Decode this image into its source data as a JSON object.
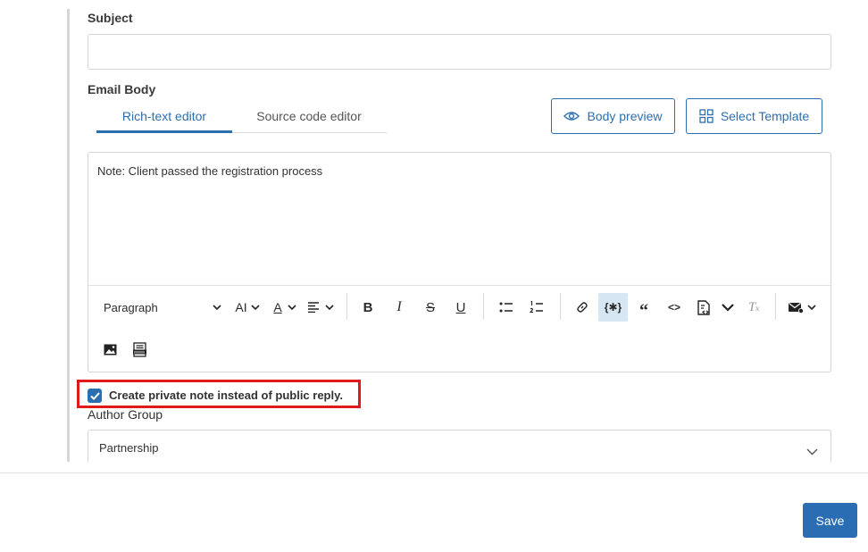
{
  "form": {
    "subject_label": "Subject",
    "subject_value": "",
    "email_body_label": "Email Body",
    "tabs": [
      {
        "label": "Rich-text editor",
        "active": true
      },
      {
        "label": "Source code editor",
        "active": false
      }
    ],
    "body_preview_label": "Body preview",
    "select_template_label": "Select Template",
    "editor_text": "Note: Client passed the registration process",
    "toolbar": {
      "paragraph_label": "Paragraph",
      "font_size_label": "AI",
      "font_color_label": "A"
    },
    "private_note_label": "Create private note instead of public reply.",
    "private_note_checked": true,
    "author_group_label": "Author Group",
    "author_group_value": "Partnership"
  },
  "footer": {
    "save_label": "Save"
  },
  "colors": {
    "accent": "#2c6fb0",
    "highlight": "#e0191b",
    "save_bg": "#2b6db3"
  }
}
